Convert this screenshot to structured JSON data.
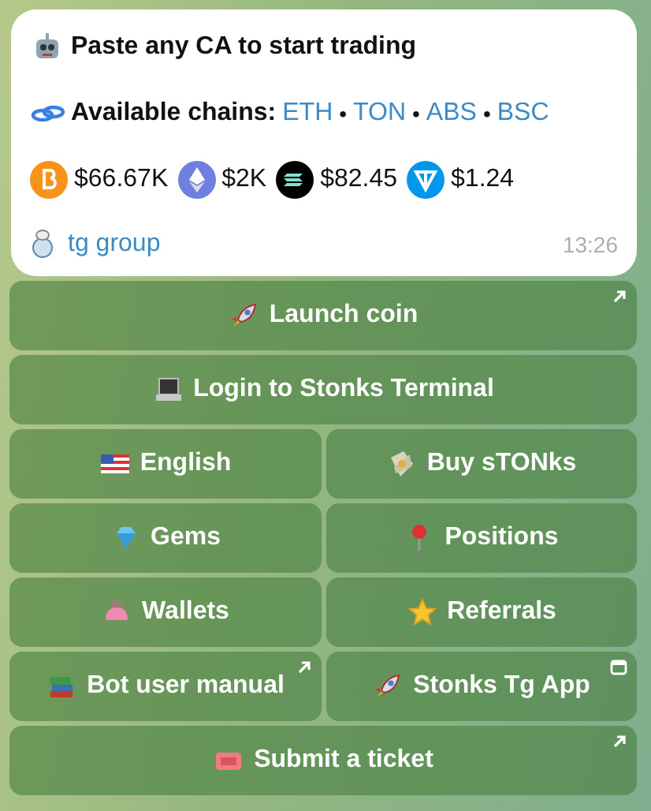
{
  "message": {
    "headline": "Paste any CA to start trading",
    "chains_label": "Available chains:",
    "chains": [
      "ETH",
      "TON",
      "ABS",
      "BSC"
    ],
    "separator": "•",
    "prices": [
      "$66.67K",
      "$2K",
      "$82.45",
      "$1.24"
    ],
    "group_link": "tg group",
    "time": "13:26"
  },
  "keyboard": [
    [
      {
        "label": "Launch coin",
        "kind": "link"
      }
    ],
    [
      {
        "label": "Login to Stonks Terminal",
        "kind": "callback"
      }
    ],
    [
      {
        "label": "English",
        "kind": "callback"
      },
      {
        "label": "Buy sTONks",
        "kind": "callback"
      }
    ],
    [
      {
        "label": "Gems",
        "kind": "callback"
      },
      {
        "label": "Positions",
        "kind": "callback"
      }
    ],
    [
      {
        "label": "Wallets",
        "kind": "callback"
      },
      {
        "label": "Referrals",
        "kind": "callback"
      }
    ],
    [
      {
        "label": "Bot user manual",
        "kind": "link"
      },
      {
        "label": "Stonks Tg App",
        "kind": "webapp"
      }
    ],
    [
      {
        "label": "Submit a ticket",
        "kind": "link"
      }
    ]
  ]
}
